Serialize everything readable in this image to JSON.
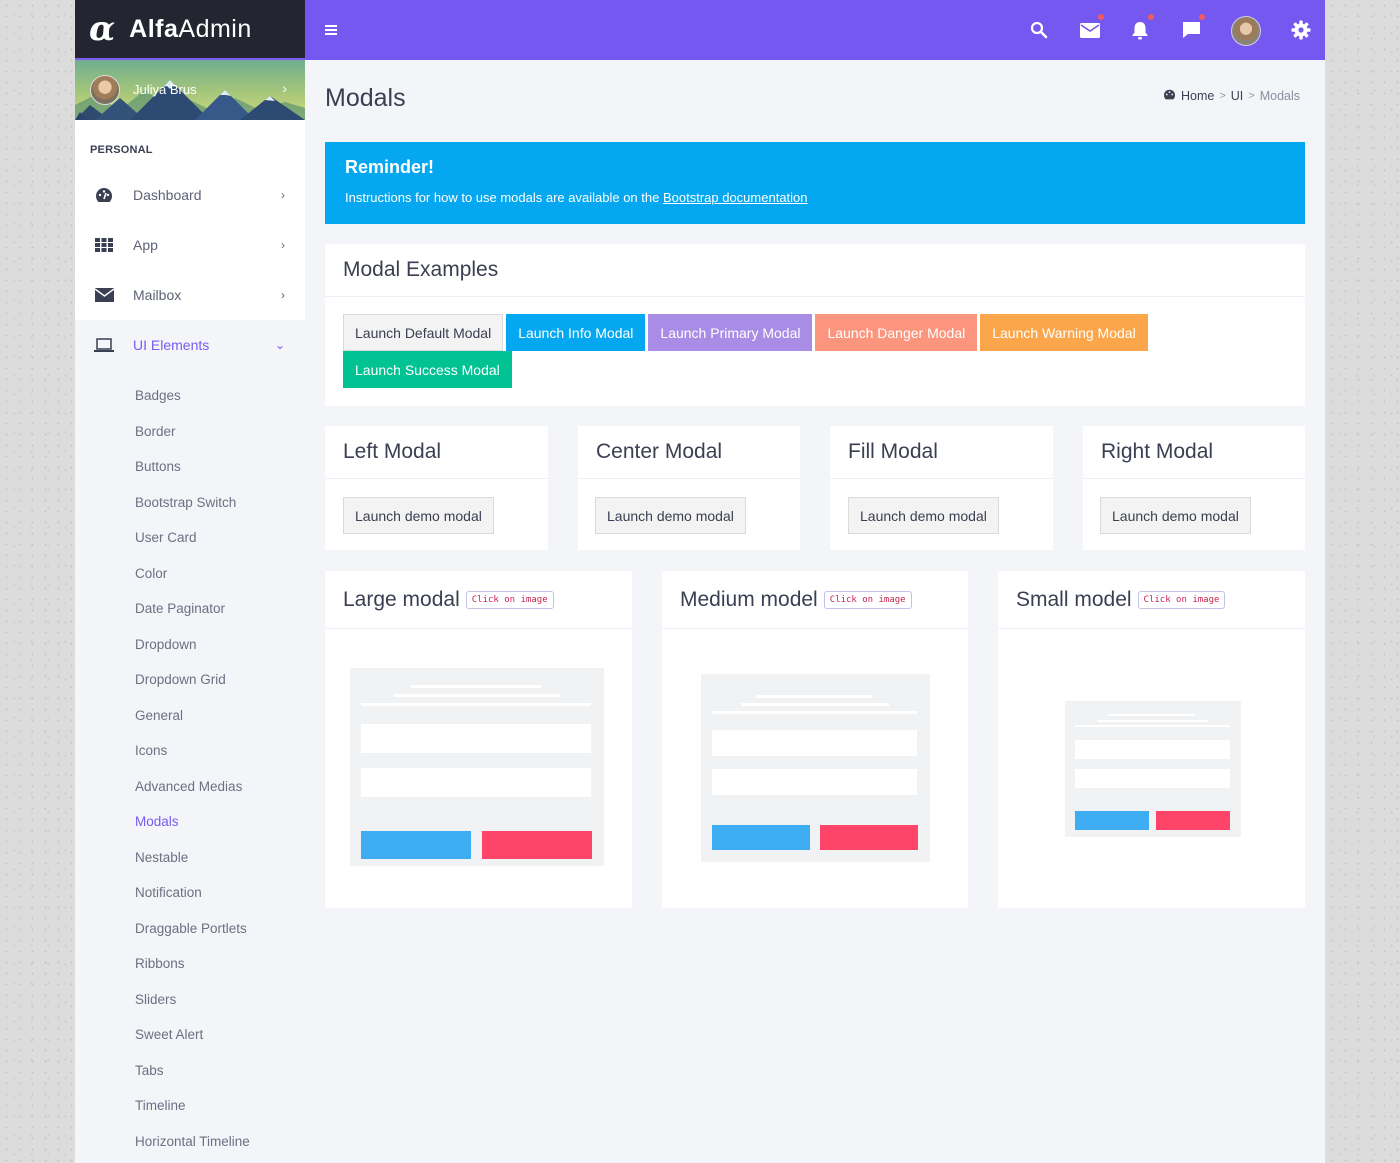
{
  "brand": {
    "logo_glyph": "α",
    "name_bold": "Alfa",
    "name_light": "Admin"
  },
  "user": {
    "name": "Juliya Brus",
    "chevron": "›"
  },
  "sidebar": {
    "section": "PERSONAL",
    "items": [
      {
        "label": "Dashboard",
        "icon": "dashboard-icon",
        "chevron": "›"
      },
      {
        "label": "App",
        "icon": "grid-icon",
        "chevron": "›"
      },
      {
        "label": "Mailbox",
        "icon": "envelope-icon",
        "chevron": "›"
      },
      {
        "label": "UI Elements",
        "icon": "laptop-icon",
        "chevron": "⌄",
        "active": true
      }
    ],
    "submenu": [
      "Badges",
      "Border",
      "Buttons",
      "Bootstrap Switch",
      "User Card",
      "Color",
      "Date Paginator",
      "Dropdown",
      "Dropdown Grid",
      "General",
      "Icons",
      "Advanced Medias",
      "Modals",
      "Nestable",
      "Notification",
      "Draggable Portlets",
      "Ribbons",
      "Sliders",
      "Sweet Alert",
      "Tabs",
      "Timeline",
      "Horizontal Timeline"
    ],
    "current_submenu": "Modals"
  },
  "topbar": {
    "icons": [
      "menu-icon",
      "search-icon",
      "mail-icon",
      "bell-icon",
      "chat-icon",
      "user-avatar",
      "gear-icon"
    ],
    "notification_dots": [
      "mail",
      "bell",
      "chat"
    ]
  },
  "page": {
    "title": "Modals",
    "breadcrumb": [
      "Home",
      "UI",
      "Modals"
    ],
    "breadcrumb_sep": ">"
  },
  "alert": {
    "title": "Reminder!",
    "text": "Instructions for how to use modals are available on the ",
    "link": "Bootstrap documentation"
  },
  "examples": {
    "title": "Modal Examples",
    "buttons": [
      {
        "label": "Launch Default Modal",
        "style": "default"
      },
      {
        "label": "Launch Info Modal",
        "style": "info"
      },
      {
        "label": "Launch Primary Modal",
        "style": "primary"
      },
      {
        "label": "Launch Danger Modal",
        "style": "danger"
      },
      {
        "label": "Launch Warning Modal",
        "style": "warning"
      },
      {
        "label": "Launch Success Modal",
        "style": "success"
      }
    ]
  },
  "position_modals": [
    {
      "title": "Left Modal",
      "button": "Launch demo modal"
    },
    {
      "title": "Center Modal",
      "button": "Launch demo modal"
    },
    {
      "title": "Fill Modal",
      "button": "Launch demo modal"
    },
    {
      "title": "Right Modal",
      "button": "Launch demo modal"
    }
  ],
  "size_modals": [
    {
      "title": "Large modal",
      "badge": "Click on image"
    },
    {
      "title": "Medium model",
      "badge": "Click on image"
    },
    {
      "title": "Small model",
      "badge": "Click on image"
    }
  ],
  "colors": {
    "accent": "#7558ef",
    "sidebar_dark": "#232630",
    "info": "#05a8f0",
    "primary": "#a98ce6",
    "danger": "#fb957d",
    "warning": "#fba64b",
    "success": "#00c292",
    "mock_blue": "#3fadf2",
    "mock_red": "#fe4468"
  }
}
